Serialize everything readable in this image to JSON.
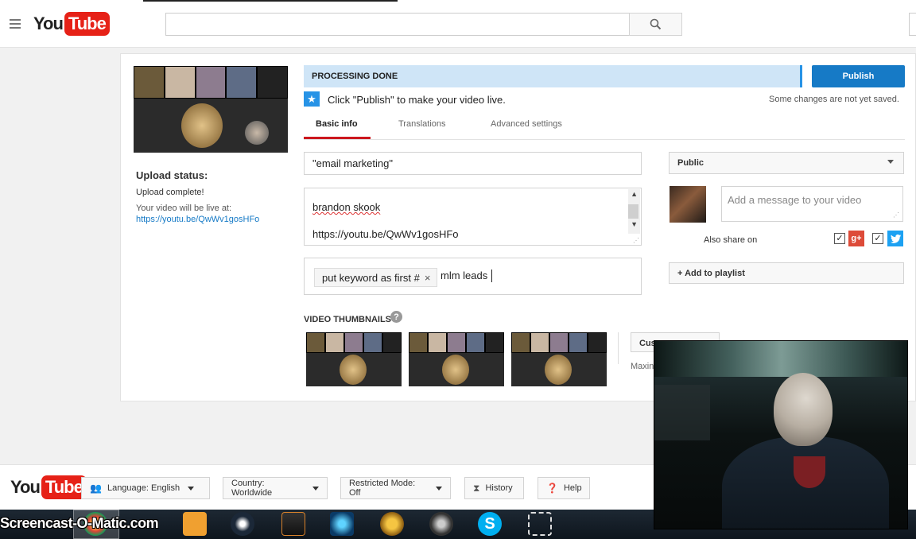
{
  "header": {
    "logo_you": "You",
    "logo_tube": "Tube",
    "search_placeholder": ""
  },
  "upload": {
    "status_title": "Upload status:",
    "status_text": "Upload complete!",
    "live_at_label": "Your video will be live at:",
    "live_url": "https://youtu.be/QwWv1gosHFo"
  },
  "processing": {
    "banner": "PROCESSING DONE",
    "publish_label": "Publish",
    "hint": "Click \"Publish\" to make your video live.",
    "unsaved": "Some changes are not yet saved."
  },
  "tabs": [
    {
      "label": "Basic info",
      "active": true
    },
    {
      "label": "Translations",
      "active": false
    },
    {
      "label": "Advanced settings",
      "active": false
    }
  ],
  "form": {
    "title_value": "\"email marketing\"",
    "description_lines": [
      "brandon skook",
      "https://youtu.be/QwWv1gosHFo"
    ],
    "tag_chip": "put keyword as first #",
    "tag_typing": "mlm leads",
    "thumbnails_label": "VIDEO THUMBNAILS",
    "custom_thumbnail_label": "Cus",
    "max_text": "Maxin"
  },
  "sidebar": {
    "privacy_value": "Public",
    "message_placeholder": "Add a message to your video",
    "also_share_label": "Also share on",
    "gplus_checked": true,
    "twitter_checked": true,
    "add_to_playlist_label": "+ Add to playlist"
  },
  "footer": {
    "language_label": "Language: English",
    "country_label": "Country: Worldwide",
    "restricted_label": "Restricted Mode: Off",
    "history_label": "History",
    "help_label": "Help"
  },
  "taskbar": {
    "watermark": "Screencast-O-Matic.com",
    "icons": [
      "chrome-icon",
      "media-player-icon",
      "steam-icon",
      "game-launcher-icon",
      "battlenet-icon",
      "wow-icon",
      "eye-app-icon",
      "skype-icon",
      "screen-capture-icon"
    ]
  },
  "colors": {
    "brand_red": "#e62117",
    "publish_blue": "#167ac6",
    "banner_blue": "#cfe5f7",
    "tab_underline": "#cc181e",
    "gplus": "#dd4b39",
    "twitter": "#1da1f2"
  }
}
